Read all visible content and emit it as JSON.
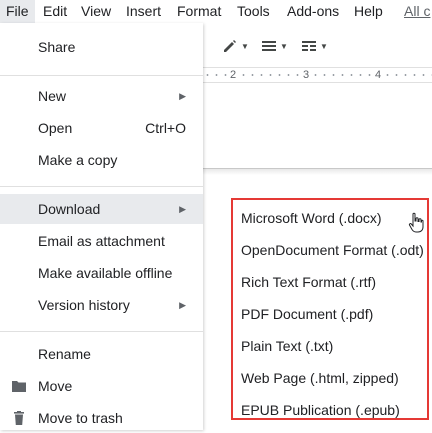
{
  "menubar": {
    "items": [
      "File",
      "Edit",
      "View",
      "Insert",
      "Format",
      "Tools",
      "Add-ons",
      "Help"
    ],
    "changes_link": "All c"
  },
  "toolbar": {
    "icons": [
      "pencil-icon",
      "align-icon",
      "line-spacing-icon"
    ]
  },
  "ruler": {
    "numbers": [
      "2",
      "3",
      "4"
    ]
  },
  "file_menu": {
    "share": "Share",
    "new": "New",
    "open": "Open",
    "open_shortcut": "Ctrl+O",
    "make_copy": "Make a copy",
    "download": "Download",
    "email_attachment": "Email as attachment",
    "offline": "Make available offline",
    "version_history": "Version history",
    "rename": "Rename",
    "move": "Move",
    "trash": "Move to trash"
  },
  "download_submenu": {
    "items": [
      "Microsoft Word (.docx)",
      "OpenDocument Format (.odt)",
      "Rich Text Format (.rtf)",
      "PDF Document (.pdf)",
      "Plain Text (.txt)",
      "Web Page (.html, zipped)",
      "EPUB Publication (.epub)"
    ]
  },
  "colors": {
    "highlight": "#e8eaed",
    "submenu_border": "#e53935"
  }
}
